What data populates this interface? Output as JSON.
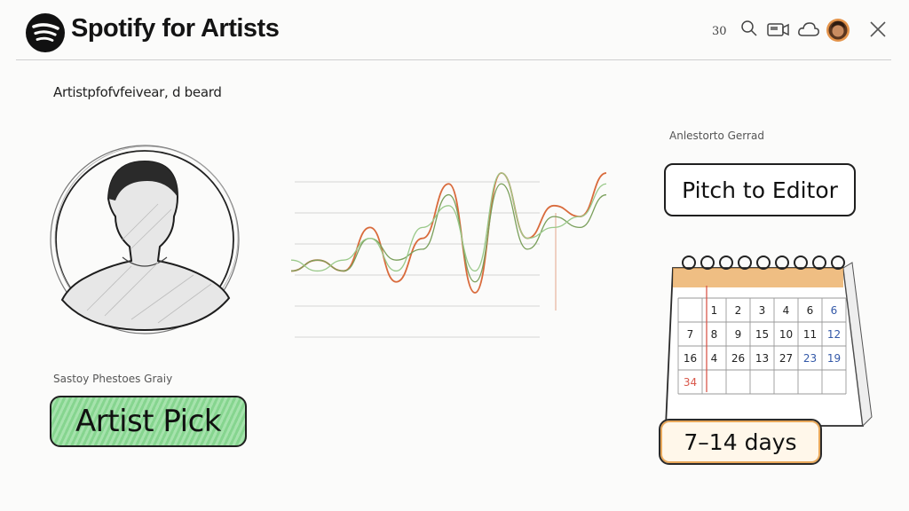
{
  "header": {
    "brand": "Spotify for Artists",
    "counter": "30",
    "icons": [
      "search-icon",
      "camera-icon",
      "cloud-icon",
      "avatar",
      "close-icon"
    ]
  },
  "breadcrumb": "Artistpfofvfeivear, d beard",
  "profile": {
    "icon": "person-silhouette-icon"
  },
  "chart_data": {
    "type": "line",
    "title": "",
    "series": [
      {
        "values": [
          0,
          1,
          0,
          4,
          -1,
          3,
          8,
          -2,
          9,
          3,
          6,
          5,
          9
        ]
      },
      {
        "values": [
          0,
          1,
          0,
          3,
          1,
          2,
          7,
          -1,
          8,
          2,
          5,
          4,
          7
        ]
      },
      {
        "values": [
          1,
          0,
          1,
          3,
          0,
          4,
          6,
          0,
          9,
          3,
          4,
          5,
          8
        ]
      }
    ],
    "colors": [
      "#d96b3c",
      "#7a9f5b",
      "#9ac98a"
    ]
  },
  "artist_pick": {
    "section_label": "Sastoy Phestoes Graiy",
    "button_label": "Artist Pick",
    "accent": "#86d58f"
  },
  "pitch": {
    "section_label": "Anlestorto Gerrad",
    "button_label": "Pitch to Editor"
  },
  "calendar": {
    "rows": [
      [
        "1",
        "2",
        "3",
        "4",
        "6",
        "6"
      ],
      [
        "7",
        "8",
        "9",
        "15",
        "10",
        "11",
        "12"
      ],
      [
        "16",
        "4",
        "26",
        "13",
        "27",
        "23",
        "19"
      ],
      [
        "34"
      ]
    ],
    "accent": "#e9a85a"
  },
  "duration": {
    "label": "7–14 days",
    "accent": "#e9a85a"
  }
}
